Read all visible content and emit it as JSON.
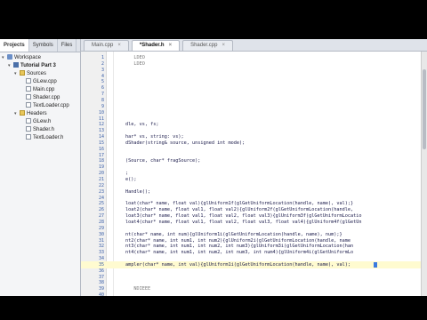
{
  "left_panel": {
    "tabs": [
      "Projects",
      "Symbols",
      "Files"
    ],
    "tree": [
      {
        "label": "Workspace",
        "level": 0,
        "icon": "workspace-icon"
      },
      {
        "label": "Tutorial Part 3",
        "level": 1,
        "icon": "project-icon",
        "bold": true
      },
      {
        "label": "Sources",
        "level": 2,
        "icon": "folder-icon"
      },
      {
        "label": "GLew.cpp",
        "level": 3,
        "icon": "file-icon"
      },
      {
        "label": "Main.cpp",
        "level": 3,
        "icon": "file-icon"
      },
      {
        "label": "Shader.cpp",
        "level": 3,
        "icon": "file-icon"
      },
      {
        "label": "TextLoader.cpp",
        "level": 3,
        "icon": "file-icon"
      },
      {
        "label": "Headers",
        "level": 2,
        "icon": "folder-icon"
      },
      {
        "label": "GLew.h",
        "level": 3,
        "icon": "file-icon"
      },
      {
        "label": "Shader.h",
        "level": 3,
        "icon": "file-icon"
      },
      {
        "label": "TextLoader.h",
        "level": 3,
        "icon": "file-icon"
      }
    ]
  },
  "editor": {
    "tabs": [
      {
        "label": "Main.cpp",
        "active": false
      },
      {
        "label": "*Shader.h",
        "active": true
      },
      {
        "label": "Shader.cpp",
        "active": false
      }
    ],
    "close_glyph": "×",
    "lines": [
      {
        "n": "1",
        "code": "   LDEO",
        "str": true
      },
      {
        "n": "2",
        "code": "   LDEO",
        "str": true
      },
      {
        "n": "3",
        "code": ""
      },
      {
        "n": "4",
        "code": ""
      },
      {
        "n": "5",
        "code": ""
      },
      {
        "n": "6",
        "code": ""
      },
      {
        "n": "7",
        "code": ""
      },
      {
        "n": "8",
        "code": ""
      },
      {
        "n": "9",
        "code": ""
      },
      {
        "n": "10",
        "code": ""
      },
      {
        "n": "11",
        "code": ""
      },
      {
        "n": "12",
        "code": "dle, vs, fs;"
      },
      {
        "n": "13",
        "code": ""
      },
      {
        "n": "14",
        "code": "har* vs, string: vs);"
      },
      {
        "n": "15",
        "code": "dShader(string& source, unsigned int mode);"
      },
      {
        "n": "16",
        "code": ""
      },
      {
        "n": "17",
        "code": ""
      },
      {
        "n": "18",
        "code": "(Source, char* fragSource);"
      },
      {
        "n": "19",
        "code": ""
      },
      {
        "n": "20",
        "code": ";"
      },
      {
        "n": "21",
        "code": "e();"
      },
      {
        "n": "22",
        "code": ""
      },
      {
        "n": "23",
        "code": "Handle();"
      },
      {
        "n": "24",
        "code": ""
      },
      {
        "n": "25",
        "code": "loat(char* name, float val){glUniform1f(glGetUniformLocation(handle, name), val);}"
      },
      {
        "n": "26",
        "code": "loat2(char* name, float val1, float val2){glUniform2f(glGetUniformLocation(handle,"
      },
      {
        "n": "27",
        "code": "loat3(char* name, float val1, float val2, float val3){glUniform3f(glGetUniformLocatio"
      },
      {
        "n": "28",
        "code": "loat4(char* name, float val1, float val2, float val3, float val4){glUniform4f(glGetUn"
      },
      {
        "n": "29",
        "code": ""
      },
      {
        "n": "30",
        "code": "nt(char* name, int num){glUniform1i(glGetUniformLocation(handle, name), num);}"
      },
      {
        "n": "31",
        "code": "nt2(char* name, int num1, int num2){glUniform2i(glGetUniformLocation(handle, name"
      },
      {
        "n": "32",
        "code": "nt3(char* name, int num1, int num2, int num3){glUniform3i(glGetUniformLocation(han"
      },
      {
        "n": "33",
        "code": "nt4(char* name, int num1, int num2, int num3, int num4){glUniform4i(glGetUniformLo"
      },
      {
        "n": "34",
        "code": ""
      },
      {
        "n": "35",
        "code": "ampler(char* name, int val){glUniform1i(glGetUniformLocation(handle, name), val);",
        "current": true
      },
      {
        "n": "36",
        "code": ""
      },
      {
        "n": "37",
        "code": ""
      },
      {
        "n": "38",
        "code": ""
      },
      {
        "n": "39",
        "code": "   NDIEEE",
        "str": true
      },
      {
        "n": "40",
        "code": ""
      }
    ]
  }
}
